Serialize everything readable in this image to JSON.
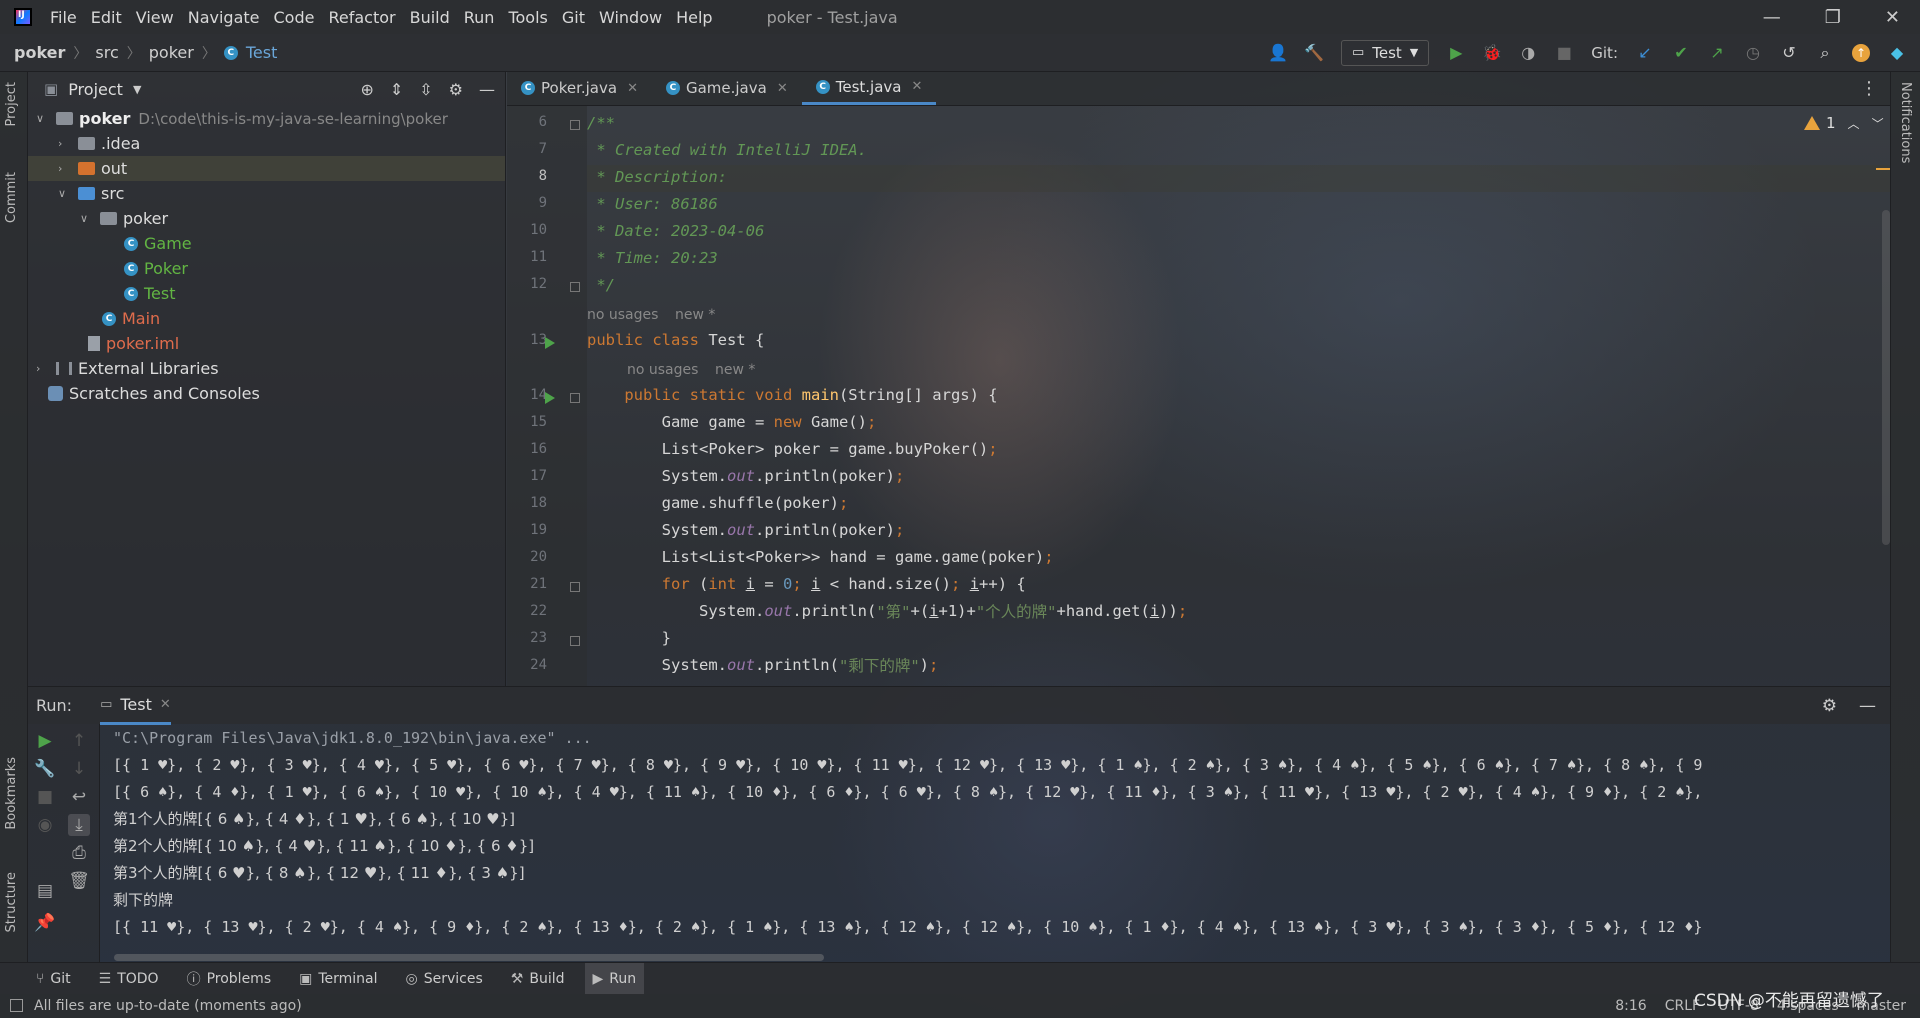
{
  "window": {
    "title": "poker - Test.java",
    "menu": [
      "File",
      "Edit",
      "View",
      "Navigate",
      "Code",
      "Refactor",
      "Build",
      "Run",
      "Tools",
      "Git",
      "Window",
      "Help"
    ],
    "controls": {
      "minimize": "—",
      "restore": "❐",
      "close": "✕"
    }
  },
  "breadcrumb": {
    "project": "poker",
    "dir": "src",
    "package": "poker",
    "file": "Test"
  },
  "nav": {
    "run_config": "Test",
    "git_label": "Git:"
  },
  "left_strip": {
    "project": "Project",
    "commit": "Commit",
    "bookmarks": "Bookmarks",
    "structure": "Structure"
  },
  "right_strip": {
    "notifications": "Notifications"
  },
  "project_panel": {
    "title": "Project",
    "tree": {
      "root_name": "poker",
      "root_path": "D:\\code\\this-is-my-java-se-learning\\poker",
      "idea": ".idea",
      "out": "out",
      "src": "src",
      "pkg": "poker",
      "game": "Game",
      "poker_class": "Poker",
      "test": "Test",
      "main": "Main",
      "iml": "poker.iml",
      "external": "External Libraries",
      "scratches": "Scratches and Consoles"
    }
  },
  "editor": {
    "tabs": [
      {
        "label": "Poker.java",
        "close": "✕"
      },
      {
        "label": "Game.java",
        "close": "✕"
      },
      {
        "label": "Test.java",
        "close": "✕"
      }
    ],
    "warnings": "1",
    "hints": {
      "usages": "no usages",
      "new": "new *"
    },
    "line_numbers": [
      "6",
      "7",
      "8",
      "9",
      "10",
      "11",
      "12",
      "13",
      "14",
      "15",
      "16",
      "17",
      "18",
      "19",
      "20",
      "21",
      "22",
      "23",
      "24"
    ],
    "code": {
      "l6": "/**",
      "l7": " * Created with IntelliJ IDEA.",
      "l8": " * Description:",
      "l9": " * User: 86186",
      "l10": " * Date: 2023-04-06",
      "l11": " * Time: 20:23",
      "l12": " */",
      "l13_kw": "public class ",
      "l13_name": "Test {",
      "l14_kw": "    public static void ",
      "l14_fn": "main",
      "l14_rest": "(String[] args) {",
      "l15_a": "        Game game = ",
      "l15_kw": "new ",
      "l15_b": "Game()",
      "l15_semi": ";",
      "l16_a": "        List<Poker> poker = game.buyPoker()",
      "l16_semi": ";",
      "l17_a": "        System.",
      "l17_out": "out",
      "l17_b": ".println(poker)",
      "l17_semi": ";",
      "l18_a": "        game.shuffle(poker)",
      "l18_semi": ";",
      "l19_a": "        System.",
      "l19_out": "out",
      "l19_b": ".println(poker)",
      "l19_semi": ";",
      "l20_a": "        List<List<Poker>> hand = game.game(poker)",
      "l20_semi": ";",
      "l21_indent": "        ",
      "l21_for": "for ",
      "l21_p": "(",
      "l21_int": "int ",
      "l21_i": "i",
      "l21_eq": " = ",
      "l21_zero": "0",
      "l21_semi1": "; ",
      "l21_i2": "i",
      "l21_cmp": " < hand.size()",
      "l21_semi2": "; ",
      "l21_i3": "i",
      "l21_end": "++) {",
      "l22_a": "            System.",
      "l22_out": "out",
      "l22_b": ".println(",
      "l22_s1": "\"第\"",
      "l22_c": "+(",
      "l22_i": "i",
      "l22_d": "+1)+",
      "l22_s2": "\"个人的牌\"",
      "l22_e": "+hand.get(",
      "l22_i2": "i",
      "l22_f": "))",
      "l22_semi": ";",
      "l23": "        }",
      "l24_a": "        System.",
      "l24_out": "out",
      "l24_b": ".println(",
      "l24_s": "\"剩下的牌\"",
      "l24_c": ")",
      "l24_semi": ";"
    }
  },
  "run_panel": {
    "label": "Run:",
    "tab": "Test",
    "tab_close": "✕",
    "console": [
      "\"C:\\Program Files\\Java\\jdk1.8.0_192\\bin\\java.exe\" ...",
      "[{ 1 ♥}, { 2 ♥}, { 3 ♥}, { 4 ♥}, { 5 ♥}, { 6 ♥}, { 7 ♥}, { 8 ♥}, { 9 ♥}, { 10 ♥}, { 11 ♥}, { 12 ♥}, { 13 ♥}, { 1 ♠}, { 2 ♠}, { 3 ♠}, { 4 ♠}, { 5 ♠}, { 6 ♠}, { 7 ♠}, { 8 ♠}, { 9",
      "[{ 6 ♠}, { 4 ♦}, { 1 ♥}, { 6 ♠}, { 10 ♥}, { 10 ♠}, { 4 ♥}, { 11 ♠}, { 10 ♦}, { 6 ♦}, { 6 ♥}, { 8 ♠}, { 12 ♥}, { 11 ♦}, { 3 ♠}, { 11 ♥}, { 13 ♥}, { 2 ♥}, { 4 ♠}, { 9 ♦}, { 2 ♠},",
      "第1个人的牌[{ 6 ♠}, { 4 ♦}, { 1 ♥}, { 6 ♠}, { 10 ♥}]",
      "第2个人的牌[{ 10 ♠}, { 4 ♥}, { 11 ♠}, { 10 ♦}, { 6 ♦}]",
      "第3个人的牌[{ 6 ♥}, { 8 ♠}, { 12 ♥}, { 11 ♦}, { 3 ♠}]",
      "剩下的牌",
      "[{ 11 ♥}, { 13 ♥}, { 2 ♥}, { 4 ♠}, { 9 ♦}, { 2 ♠}, { 13 ♦}, { 2 ♠}, { 1 ♠}, { 13 ♠}, { 12 ♠}, { 12 ♠}, { 10 ♠}, { 1 ♦}, { 4 ♠}, { 13 ♠}, { 3 ♥}, { 3 ♠}, { 3 ♦}, { 5 ♦}, { 12 ♦}"
    ]
  },
  "bottom_tools": [
    "Git",
    "TODO",
    "Problems",
    "Terminal",
    "Services",
    "Build",
    "Run"
  ],
  "status": {
    "message": "All files are up-to-date (moments ago)",
    "position": "8:16",
    "line_sep": "CRLF",
    "encoding": "UTF-8",
    "indent": "4 spaces",
    "branch": "master"
  },
  "watermark": "CSDN @不能再留遗憾了",
  "colors": {
    "accent": "#4a88c7",
    "run_green": "#4ea34a",
    "warning": "#e8a33d"
  }
}
